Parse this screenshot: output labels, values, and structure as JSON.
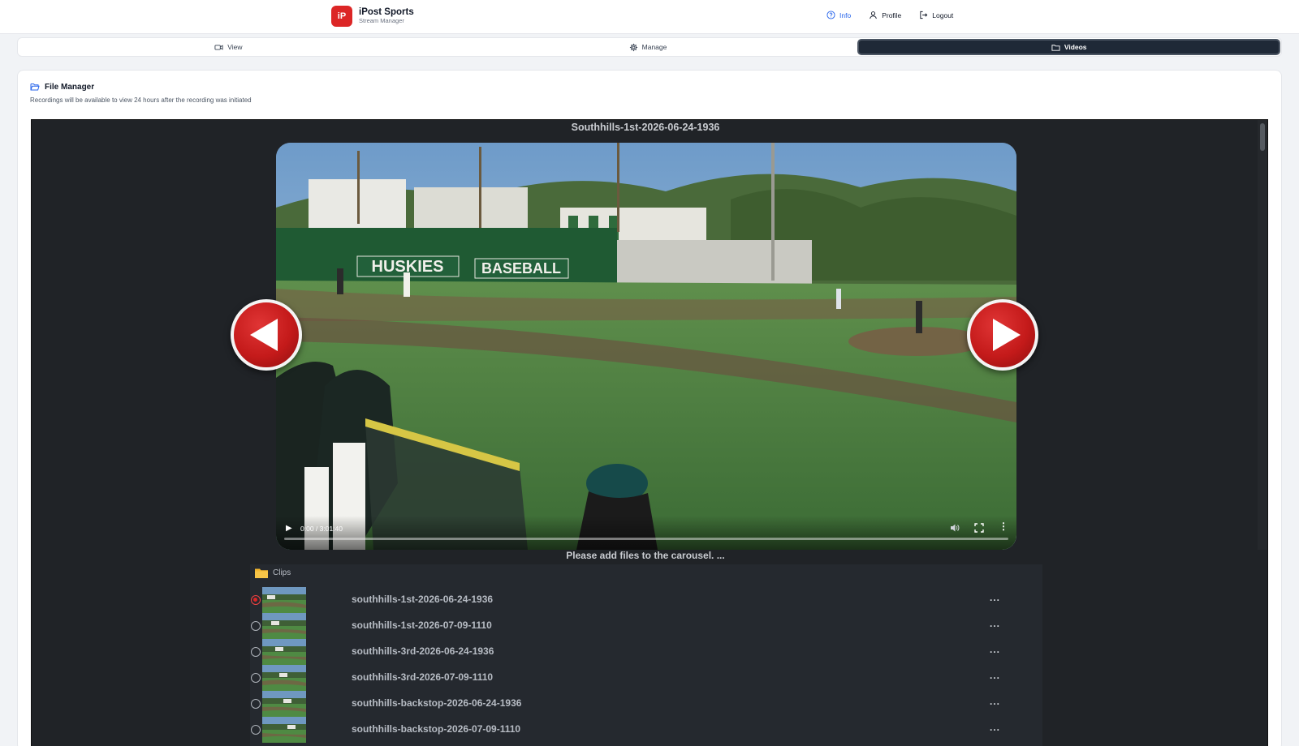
{
  "brand": {
    "logo_text": "iP",
    "title": "iPost Sports",
    "subtitle": "Stream Manager",
    "logo_color": "#dc2626"
  },
  "topnav": [
    {
      "label": "Info",
      "icon": "info-circle-icon",
      "active": true
    },
    {
      "label": "Profile",
      "icon": "user-icon",
      "active": false
    },
    {
      "label": "Logout",
      "icon": "logout-icon",
      "active": false
    }
  ],
  "tabs": [
    {
      "label": "View",
      "icon": "video-camera-icon",
      "active": false
    },
    {
      "label": "Manage",
      "icon": "gear-icon",
      "active": false
    },
    {
      "label": "Videos",
      "icon": "folder-icon",
      "active": true
    }
  ],
  "file_manager": {
    "title": "File Manager",
    "subtitle": "Recordings will be available to view 24 hours after the recording was initiated"
  },
  "player": {
    "title": "Southhills-1st-2026-06-24-1936",
    "time": "0:00 / 3:01:40",
    "progress": 0,
    "prev_icon": "arrow-left-icon",
    "next_icon": "arrow-right-icon",
    "carousel_message": "Please add files to the carousel. ..."
  },
  "clips": {
    "title": "Clips",
    "icon": "folder-icon",
    "items": [
      {
        "name": "southhills-1st-2026-06-24-1936",
        "selected": true,
        "menu": "..."
      },
      {
        "name": "southhills-1st-2026-07-09-1110",
        "selected": false,
        "menu": "..."
      },
      {
        "name": "southhills-3rd-2026-06-24-1936",
        "selected": false,
        "menu": "..."
      },
      {
        "name": "southhills-3rd-2026-07-09-1110",
        "selected": false,
        "menu": "..."
      },
      {
        "name": "southhills-backstop-2026-06-24-1936",
        "selected": false,
        "menu": "..."
      },
      {
        "name": "southhills-backstop-2026-07-09-1110",
        "selected": false,
        "menu": "..."
      }
    ]
  },
  "colors": {
    "accent": "#2563eb",
    "active_tab": "#1f2937",
    "arrow_red": "#c41a1a",
    "player_bg": "#202327"
  }
}
